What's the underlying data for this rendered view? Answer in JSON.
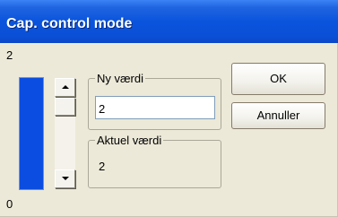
{
  "window": {
    "title": "Cap. control mode"
  },
  "scale": {
    "max_label": "2",
    "min_label": "0"
  },
  "level_bar": {
    "color": "#0b4de0",
    "fraction": 1.0
  },
  "new_value_group": {
    "label": "Ny værdi",
    "input_value": "2"
  },
  "current_value_group": {
    "label": "Aktuel værdi",
    "value": "2"
  },
  "buttons": {
    "ok": "OK",
    "cancel": "Annuller"
  },
  "colors": {
    "title_bar": "#0a54dd",
    "dialog_bg": "#ece9d8"
  }
}
